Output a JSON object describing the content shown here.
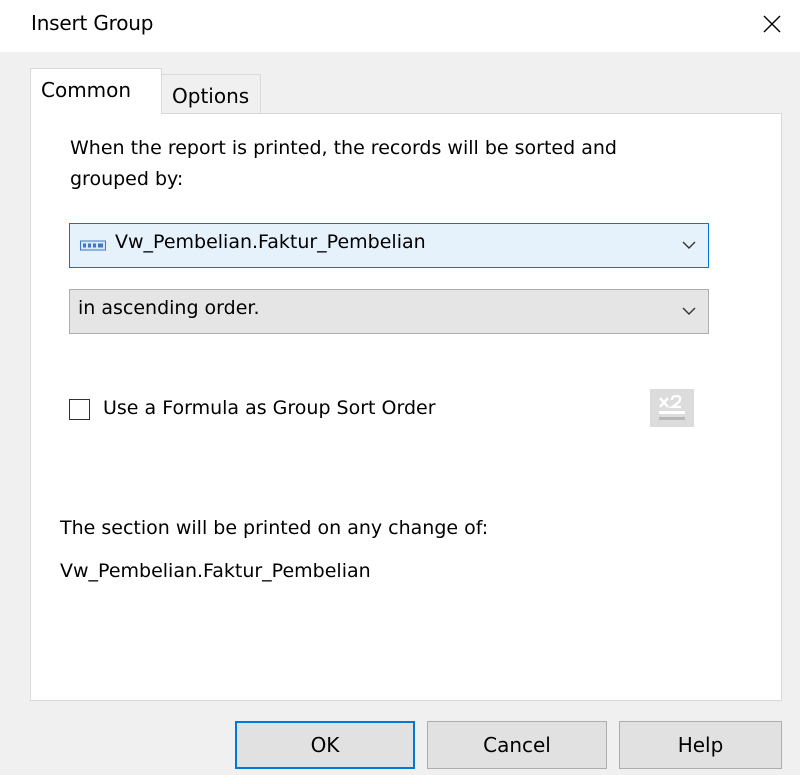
{
  "window": {
    "title": "Insert Group"
  },
  "tabs": [
    {
      "label": "Common",
      "active": true
    },
    {
      "label": "Options",
      "active": false
    }
  ],
  "common": {
    "description": "When the report is printed, the records will be sorted and grouped by:",
    "group_field": {
      "value": "Vw_Pembelian.Faktur_Pembelian",
      "icon": "database-field-icon"
    },
    "sort_order": {
      "value": "in ascending order."
    },
    "formula_checkbox": {
      "label": "Use a Formula as Group Sort Order",
      "checked": false
    },
    "formula_button_icon": "formula-editor-icon",
    "section_label": "The section will be printed on any change of:",
    "section_value": "Vw_Pembelian.Faktur_Pembelian"
  },
  "buttons": {
    "ok": "OK",
    "cancel": "Cancel",
    "help": "Help"
  },
  "colors": {
    "focus": "#0078d7",
    "panel": "#ffffff",
    "window": "#f0f0f0",
    "button": "#e1e1e1"
  }
}
